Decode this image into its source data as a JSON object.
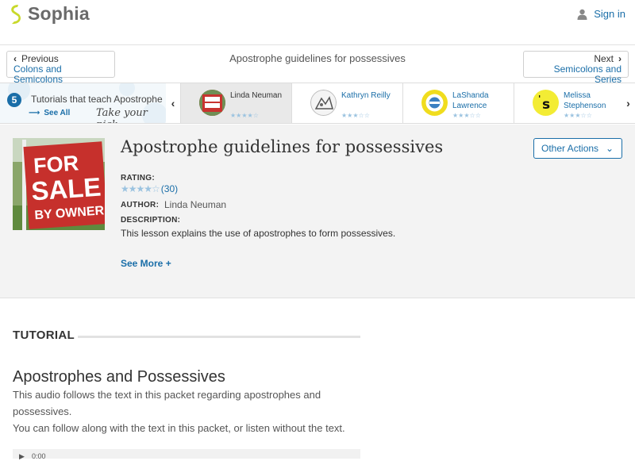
{
  "header": {
    "brand": "Sophia",
    "signin_label": "Sign in",
    "accent": "#1a6ea8",
    "logo_color": "#c8d92a"
  },
  "nav": {
    "prev": {
      "small": "Previous",
      "link": "Colons and Semicolons"
    },
    "next": {
      "small": "Next",
      "link": "Semicolons and Series"
    },
    "title": "Apostrophe guidelines for possessives"
  },
  "tutors_strip": {
    "count": "5",
    "label": "Tutorials that teach Apostrophe",
    "see_all": "See All",
    "pick": "Take your pick:",
    "tutors": [
      {
        "name": "Linda Neuman",
        "stars": "★★★★☆",
        "selected": true
      },
      {
        "name": "Kathryn Reilly",
        "stars": "★★★☆☆",
        "selected": false
      },
      {
        "name": "LaShanda Lawrence",
        "stars": "★★★☆☆",
        "selected": false
      },
      {
        "name": "Melissa Stephenson",
        "stars": "★★★☆☆",
        "selected": false
      }
    ]
  },
  "lesson": {
    "title": "Apostrophe guidelines for possessives",
    "actions_label": "Other Actions",
    "rating_label": "RATING:",
    "rating_stars": "★★★★☆",
    "rating_count": "(30)",
    "author_label": "AUTHOR:",
    "author": "Linda Neuman",
    "description_label": "DESCRIPTION:",
    "description": "This lesson explains the use of apostrophes to form possessives.",
    "see_more": "See More +",
    "thumb_sign": {
      "line1": "FOR",
      "line2": "SALE",
      "line3": "BY OWNER"
    }
  },
  "tutorial": {
    "section_label": "TUTORIAL",
    "heading": "Apostrophes and Possessives",
    "para1_line1": "This audio follows the text in this packet regarding apostrophes and",
    "para1_line2": "possessives.",
    "para2": "You can follow along with the text in this packet, or listen without the text.",
    "audio_time": "0:00"
  }
}
